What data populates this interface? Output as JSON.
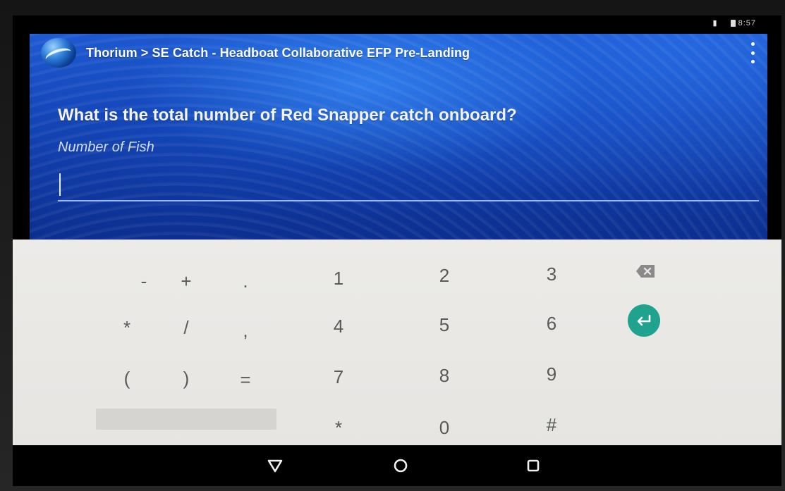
{
  "status_bar": {
    "signal": "▮",
    "time": "8:57"
  },
  "toolbar": {
    "title": "Thorium > SE Catch - Headboat Collaborative EFP Pre-Landing"
  },
  "question": {
    "text": "What is the total number of Red Snapper catch onboard?",
    "field_label": "Number of Fish",
    "value": ""
  },
  "keyboard": {
    "symbols": [
      "-",
      "+",
      ".",
      "*",
      "/",
      ",",
      "(",
      ")",
      "="
    ],
    "digits": [
      "1",
      "2",
      "3",
      "4",
      "5",
      "6",
      "7",
      "8",
      "9",
      "*",
      "0",
      "#"
    ]
  },
  "colors": {
    "panel_blue": "#1445b7",
    "enter_green": "#1fa38e",
    "keyboard_bg": "#ecebe8"
  },
  "icons": {
    "back": "triangle-down-icon",
    "home": "circle-icon",
    "recents": "square-icon",
    "backspace": "backspace-icon",
    "enter": "enter-arrow-icon",
    "menu": "overflow-dots-icon"
  }
}
